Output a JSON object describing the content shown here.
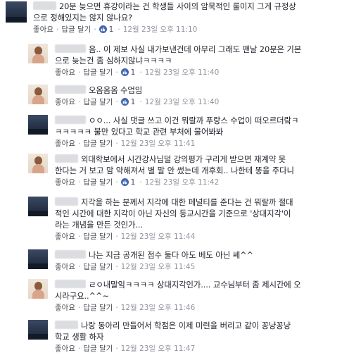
{
  "ui": {
    "like_label": "좋아요",
    "reply_label": "답글 달기",
    "separator": "·",
    "like_color": "#4267b2"
  },
  "comments": [
    {
      "author": "▌▌▌",
      "text": "20분 늦으면 휴강이라는 건 학생들 사이의 암묵적인 룰이지 그게 규정상\n으로 정해있지는 않지 않나요?",
      "likes": "1",
      "time": "12월 23일 오후 11:10"
    },
    {
      "author": "▌▌▌▌",
      "text": "음.. 이 제보 사실 내가보낸건데 아무리 그래도 맨날 20분은 기본\n으로 늦는건 좀 심하지않냐ㅋㅋㅋㅋ",
      "likes": "1",
      "time": "12월 23일 오후 11:40"
    },
    {
      "author": "▌▌▌▌",
      "text": "오옴옴옴 수업임",
      "likes": "1",
      "time": "12월 23일 오후 11:40"
    },
    {
      "author": "▌▌▌▌",
      "text": "ㅇㅇ... 사실 댓글 쓰고 이건 뭐랄까 푸랑스 수업이 떠오르더랔ㅋ\nㅋㅋㅋㅋㅋ 불만 있다고 학교 관련 부처에 물어봐봐",
      "likes": "",
      "time": "12월 23일 오후 11:41"
    },
    {
      "author": "▌▌▌",
      "text": "외대학보에서 시간강사님덜 강의평가 구리게 받으면 재계약 못\n한다는 거 보고 맘 약해져서 별 말 안 썼는데 개후회.. 나한테 똥을 주다니",
      "likes": "1",
      "time": "12월 23일 오후 11:42"
    },
    {
      "author": "▌▌▌",
      "text": "지각을 하는 분께서 지각에 대한 페널티를 준다는 건 뭐랄까 절대\n적인 시간에 대한 지각이 아닌 자신의 등교시간을 기준으로 '상대지각'이\n라는 개념을 만든 것인가...",
      "likes": "",
      "time": "12월 23일 오후 11:44"
    },
    {
      "author": "▌▌▌▌",
      "text": "나는 지금 공개된 점수 둘다 아도 베도 아닌 쎄^^",
      "likes": "",
      "time": "12월 23일 오후 11:45"
    },
    {
      "author": "▌▌▌▌",
      "text": "ㄹㅇ내말잌ㅋㅋㅋㅋ 상대지각인가.... 교수님부터 좀 제시간에 오\n시라구요..^^~",
      "likes": "",
      "time": "12월 23일 오후 11:46"
    },
    {
      "author": "▌▌▌",
      "text": "나랑 동아리 만들어서 학점은 이제 미련을 버리고 같이 꽁냥꽁냥\n학교 생활 하자",
      "likes": "",
      "time": "12월 23일 오후 11:47"
    }
  ]
}
